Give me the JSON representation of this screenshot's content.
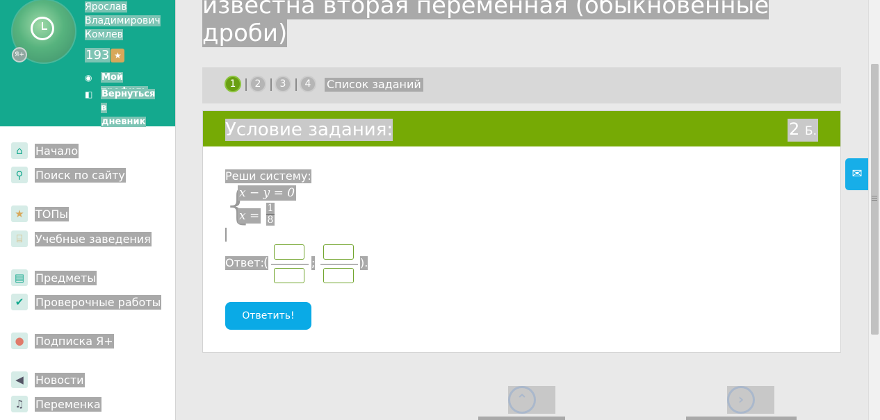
{
  "sidebar": {
    "user": {
      "name_lines": [
        "Ярослав",
        "Владимирович",
        "Комлев"
      ],
      "points": "193",
      "badge": "Я+"
    },
    "profile_link": "Мой профиль",
    "back_link_lines": [
      "Вернуться в",
      "дневник"
    ],
    "nav": [
      {
        "label": "Начало",
        "icon": "home-icon"
      },
      {
        "label": "Поиск по сайту",
        "icon": "search-icon"
      },
      {
        "label": "ТОПы",
        "icon": "star-icon"
      },
      {
        "label": "Учебные заведения",
        "icon": "institution-icon"
      },
      {
        "label": "Предметы",
        "icon": "book-icon"
      },
      {
        "label": "Проверочные работы",
        "icon": "check-circle-icon"
      },
      {
        "label": "Подписка Я+",
        "icon": "ya-plus-icon"
      },
      {
        "label": "Новости",
        "icon": "megaphone-icon"
      },
      {
        "label": "Переменка",
        "icon": "bell-icon"
      }
    ]
  },
  "main": {
    "title_lines": [
      "известна вторая переменная (обыкновенные",
      "дроби)"
    ],
    "tabs": [
      "1",
      "2",
      "3",
      "4"
    ],
    "active_tab": "1",
    "task_list": "Список заданий",
    "card": {
      "header": "Условие задания:",
      "points_value": "2",
      "points_unit": "Б.",
      "prompt": "Реши систему:",
      "eq1": "x − y = 0",
      "eq2": "x =",
      "eq2_num": "1",
      "eq2_den": "8",
      "answer_label": "Ответ:",
      "open_paren": "(",
      "separator": ";",
      "close_paren": ").",
      "submit": "Ответить!"
    }
  },
  "colors": {
    "accent": "#76aa05",
    "profile_bg": "#14a98e",
    "button": "#0aaae6"
  }
}
